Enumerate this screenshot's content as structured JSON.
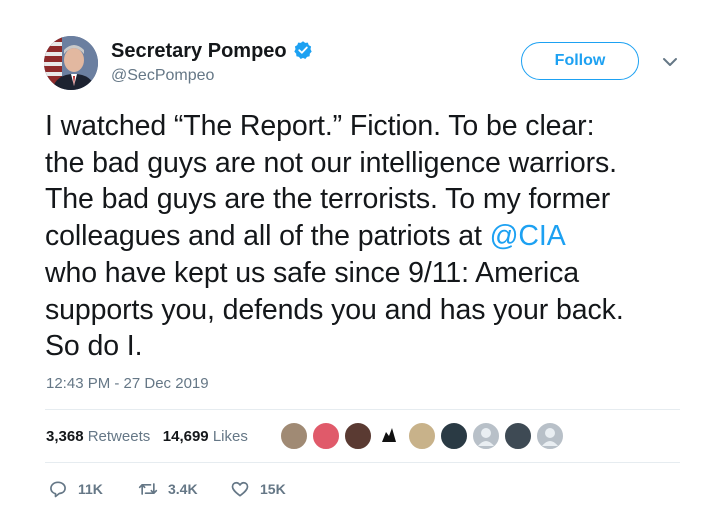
{
  "user": {
    "name": "Secretary Pompeo",
    "handle": "@SecPompeo"
  },
  "follow_button": {
    "label": "Follow"
  },
  "tweet": {
    "text_before": "I watched “The Report.” Fiction. To be clear:\nthe bad guys are not our intelligence warriors.\nThe bad guys are the terrorists. To my former\ncolleagues and all of the patriots at ",
    "mention": "@CIA",
    "text_after": "\nwho have kept us safe since 9/11: America\nsupports you, defends you and has your back.\nSo do I.",
    "timestamp": "12:43 PM - 27 Dec 2019"
  },
  "stats": {
    "retweets_count": "3,368",
    "retweets_label": "Retweets",
    "likes_count": "14,699",
    "likes_label": "Likes"
  },
  "actions": {
    "replies": "11K",
    "retweets": "3.4K",
    "likes": "15K"
  },
  "colors": {
    "accent": "#1da1f2",
    "text": "#14171a",
    "muted": "#657786",
    "divider": "#e6ecf0"
  },
  "icons": [
    "verified-badge-icon",
    "chevron-down-icon",
    "reply-icon",
    "retweet-icon",
    "like-icon"
  ]
}
